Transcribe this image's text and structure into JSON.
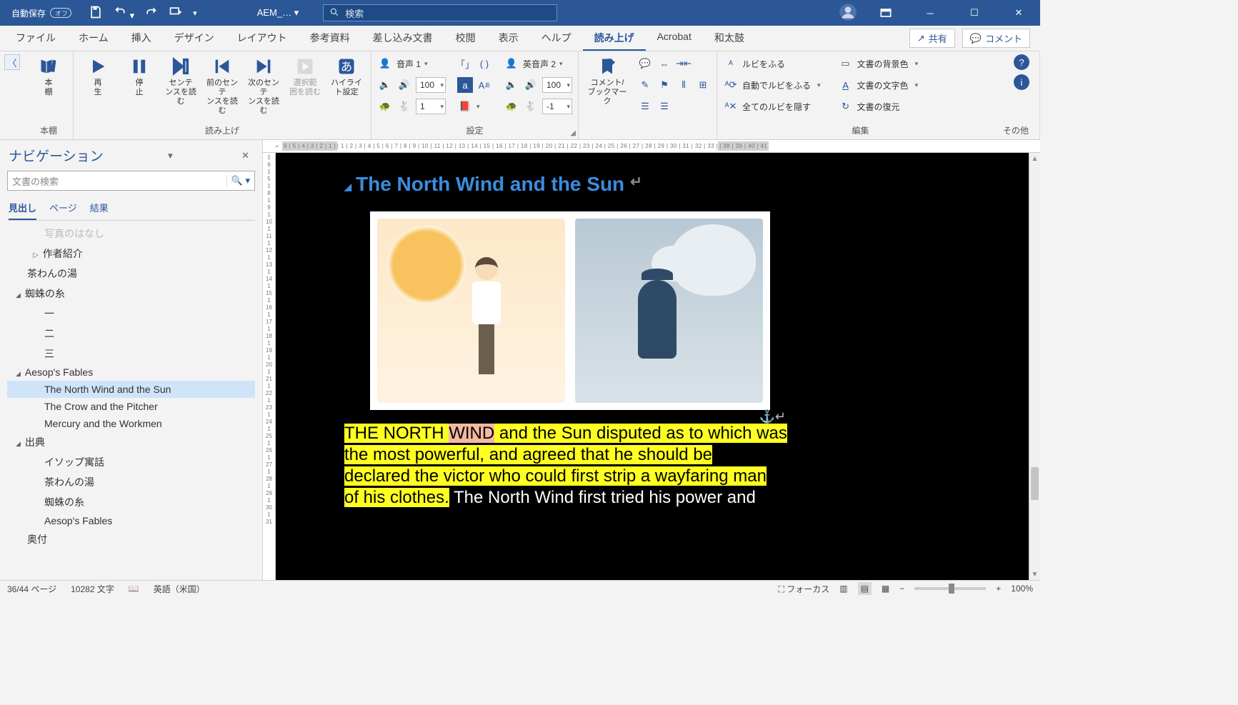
{
  "titlebar": {
    "autosave_label": "自動保存",
    "autosave_state": "オフ",
    "doc_name": "AEM_…",
    "search_placeholder": "検索"
  },
  "tabs": {
    "items": [
      "ファイル",
      "ホーム",
      "挿入",
      "デザイン",
      "レイアウト",
      "参考資料",
      "差し込み文書",
      "校閲",
      "表示",
      "ヘルプ",
      "読み上げ",
      "Acrobat",
      "和太鼓"
    ],
    "active_index": 10,
    "share": "共有",
    "comment": "コメント"
  },
  "ribbon": {
    "groups": {
      "bookshelf": {
        "label": "本棚",
        "btn": "本\n棚"
      },
      "read": {
        "label": "読み上げ",
        "play": "再\n生",
        "stop": "停\n止",
        "sentence": "センテ\nンスを読む",
        "prev_sentence": "前のセンテ\nンスを読む",
        "next_sentence": "次のセンテ\nンスを読む",
        "selection": "選択範\n囲を読む",
        "highlight": "ハイライ\nト設定"
      },
      "settings": {
        "label": "設定",
        "voice1": "音声 1",
        "voice2": "英音声 2",
        "rate1": "100",
        "pitch1": "1",
        "rate2": "100",
        "pitch2": "-1"
      },
      "bookmark": {
        "btn": "コメント/\nブックマーク"
      },
      "edit": {
        "label": "編集",
        "ruby": "ルビをふる",
        "auto_ruby": "自動でルビをふる",
        "hide_all_ruby": "全てのルビを隠す",
        "bg_color": "文書の背景色",
        "text_color": "文書の文字色",
        "restore": "文書の復元"
      },
      "other": {
        "label": "その他"
      }
    }
  },
  "nav": {
    "title": "ナビゲーション",
    "search_placeholder": "文書の検索",
    "tabs": [
      "見出し",
      "ページ",
      "結果"
    ],
    "active_tab": 0,
    "tree": [
      {
        "level": 2,
        "text": "写真のはなし",
        "caret": "none",
        "truncated": true
      },
      {
        "level": 2,
        "text": "作者紹介",
        "caret": "right"
      },
      {
        "level": 1,
        "text": "茶わんの湯",
        "caret": "none"
      },
      {
        "level": 1,
        "text": "蜘蛛の糸",
        "caret": "down"
      },
      {
        "level": 2,
        "text": "一",
        "caret": "none"
      },
      {
        "level": 2,
        "text": "二",
        "caret": "none"
      },
      {
        "level": 2,
        "text": "三",
        "caret": "none"
      },
      {
        "level": 1,
        "text": "Aesop's Fables",
        "caret": "down"
      },
      {
        "level": 2,
        "text": "The North Wind and the Sun",
        "caret": "none",
        "selected": true
      },
      {
        "level": 2,
        "text": "The Crow and the Pitcher",
        "caret": "none"
      },
      {
        "level": 2,
        "text": "Mercury and the Workmen",
        "caret": "none"
      },
      {
        "level": 1,
        "text": "出典",
        "caret": "down"
      },
      {
        "level": 2,
        "text": "イソップ寓話",
        "caret": "none"
      },
      {
        "level": 2,
        "text": "茶わんの湯",
        "caret": "none"
      },
      {
        "level": 2,
        "text": "蜘蛛の糸",
        "caret": "none"
      },
      {
        "level": 2,
        "text": "Aesop's Fables",
        "caret": "none"
      },
      {
        "level": 1,
        "text": "奥付",
        "caret": "none"
      }
    ]
  },
  "document": {
    "heading": "The North Wind and the Sun",
    "pilcrow": "↵",
    "body_hl_pre": "THE NORTH ",
    "body_hl_word": "WIND",
    "body_hl_post1": " and the Sun disputed as to which was",
    "body_hl_line2": "the most powerful, and agreed that he should be",
    "body_hl_line3": "declared the victor who could first strip a wayfaring man",
    "body_hl_line4a": "of his clothes.",
    "body_plain": " The North Wind first tried his power and"
  },
  "ruler_h_dark": "6 | 5 | 4 | 3 | 2 | 1 |",
  "ruler_h_light": " | 1 | 2 | 3 | 4 | 5 | 6 | 7 | 8 | 9 | 10 | 11 | 12 | 13 | 14 | 15 | 16 | 17 | 18 | 19 | 20 | 21 | 22 | 23 | 24 | 25 | 26 | 27 | 28 | 29 | 30 | 31 | 32 | 33 |",
  "ruler_h_dark2": "   | 38 | 39 | 40 | 41",
  "ruler_v": [
    "1",
    "6",
    "1",
    "5",
    "1",
    "8",
    "1",
    "9",
    "1",
    "10",
    "1",
    "11",
    "1",
    "12",
    "1",
    "13",
    "1",
    "14",
    "1",
    "15",
    "1",
    "16",
    "1",
    "17",
    "1",
    "18",
    "1",
    "19",
    "1",
    "20",
    "1",
    "21",
    "1",
    "22",
    "1",
    "23",
    "1",
    "24",
    "1",
    "25",
    "1",
    "26",
    "1",
    "27",
    "1",
    "28",
    "1",
    "29",
    "1",
    "30",
    "1",
    "31"
  ],
  "status": {
    "page": "36/44 ページ",
    "words": "10282 文字",
    "lang": "英語（米国）",
    "focus": "フォーカス",
    "zoom": "100%"
  }
}
